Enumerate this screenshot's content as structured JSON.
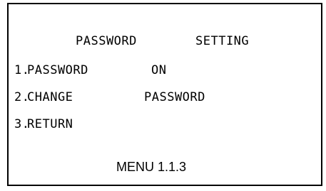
{
  "menu": {
    "title_left": "PASSWORD",
    "title_right": "SETTING",
    "items": [
      {
        "number": "1.",
        "label": "PASSWORD",
        "value": "ON"
      },
      {
        "number": "2.",
        "label": "CHANGE",
        "value": "PASSWORD"
      },
      {
        "number": "3.",
        "label": "RETURN",
        "value": ""
      }
    ],
    "footer": "MENU 1.1.3"
  }
}
